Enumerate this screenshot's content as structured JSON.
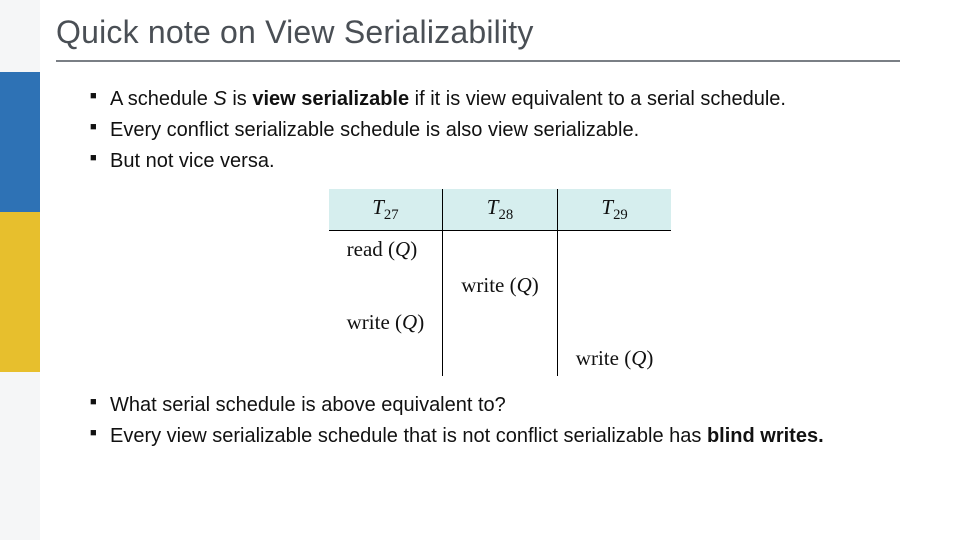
{
  "title": "Quick note on View Serializability",
  "bullets_top": {
    "b1_prefix": "A schedule ",
    "b1_S": "S",
    "b1_mid1": " is ",
    "b1_bold": "view serializable",
    "b1_suffix": " if it is view equivalent to a serial schedule.",
    "b2": "Every conflict serializable schedule is also view serializable.",
    "b3": "But not vice versa."
  },
  "schedule": {
    "headers": [
      "T",
      "T",
      "T"
    ],
    "header_subs": [
      "27",
      "28",
      "29"
    ],
    "ops": {
      "read": "read",
      "write": "write",
      "arg": "Q"
    }
  },
  "bullets_bottom": {
    "b4": "What serial schedule is above equivalent to?",
    "b5_prefix": "Every view serializable schedule that is not conflict serializable has ",
    "b5_bold": "blind writes.",
    "b5_suffix": ""
  }
}
